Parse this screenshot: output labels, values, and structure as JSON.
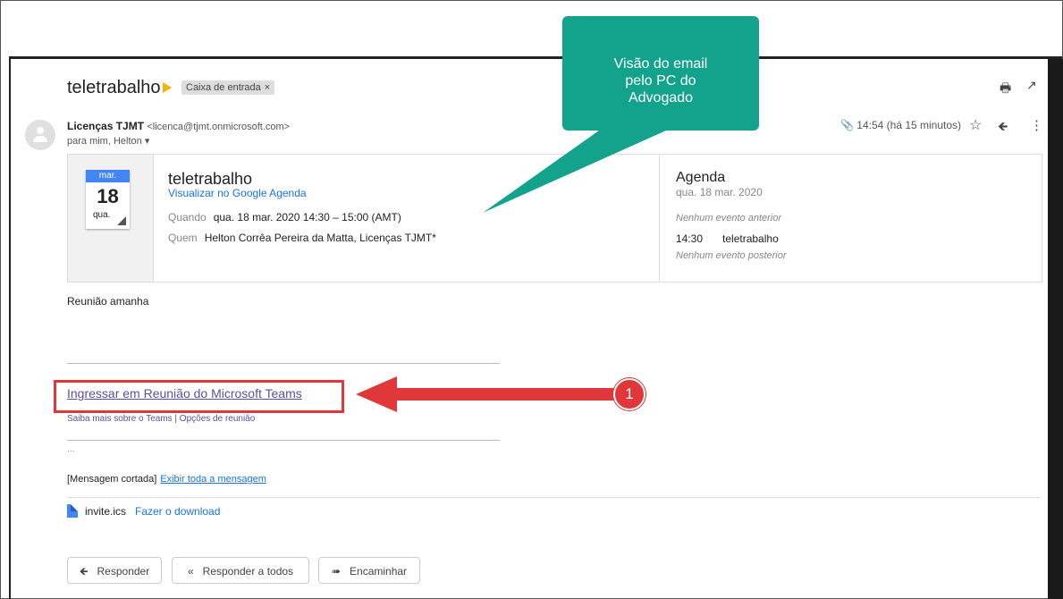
{
  "email": {
    "subject": "teletrabalho",
    "label_chip": "Caixa de entrada",
    "label_close": "×",
    "sender_name": "Licenças TJMT",
    "sender_email": "<licenca@tjmt.onmicrosoft.com>",
    "to_line": "para mim, Helton",
    "timestamp": "14:54 (há 15 minutos)",
    "body_text": "Reunião amanha"
  },
  "event_card": {
    "cal_month": "mar.",
    "cal_day": "18",
    "cal_weekday": "qua.",
    "title": "teletrabalho",
    "view_link": "Visualizar no Google Agenda",
    "when_label": "Quando",
    "when_value": "qua. 18 mar. 2020 14:30 – 15:00 (AMT)",
    "who_label": "Quem",
    "who_value": "Helton Corrêa Pereira da Matta, Licenças TJMT*"
  },
  "agenda": {
    "title": "Agenda",
    "date": "qua. 18 mar. 2020",
    "no_previous": "Nenhum evento anterior",
    "item_time": "14:30",
    "item_name": "teletrabalho",
    "no_next": "Nenhum evento posterior"
  },
  "teams": {
    "join_link": "Ingressar em Reunião do Microsoft Teams",
    "sub_links": "Saiba mais sobre o Teams | Opções de reunião",
    "ellipsis": "..."
  },
  "truncated": {
    "label": "[Mensagem cortada]",
    "link": "Exibir toda a mensagem"
  },
  "attachment": {
    "file_name": "invite.ics",
    "download_label": "Fazer o download"
  },
  "actions": {
    "reply": "Responder",
    "reply_all": "Responder a todos",
    "forward": "Encaminhar"
  },
  "annotation": {
    "callout_line1": "Visão do email",
    "callout_line2": "pelo PC do",
    "callout_line3": "Advogado",
    "badge_number": "1"
  },
  "icons": {
    "print": "print-icon",
    "open_new_window": "open-in-new-window-icon",
    "attachment": "paperclip-icon",
    "star": "star-icon",
    "reply": "reply-icon",
    "more": "more-vert-icon",
    "file": "file-icon",
    "forward": "forward-icon",
    "reply_all": "reply-all-icon"
  },
  "colors": {
    "callout_bg": "#13a38d",
    "highlight_red": "#e0383a",
    "link_blue": "#1a73e8",
    "teams_link": "#5e4fa2",
    "label_yellow": "#f4b400"
  }
}
